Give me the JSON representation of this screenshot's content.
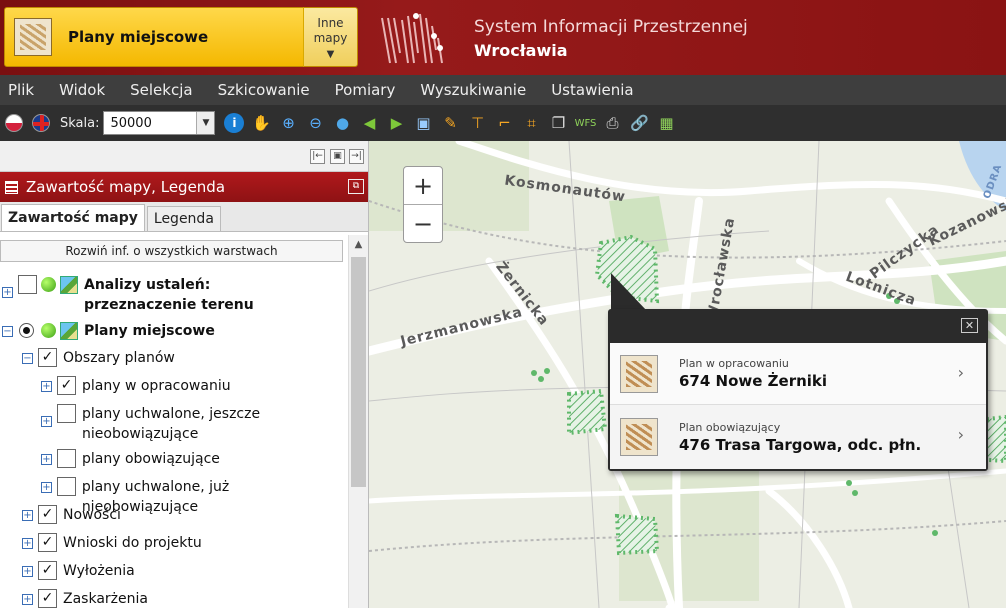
{
  "header": {
    "plan_title": "Plany miejscowe",
    "other_maps_line1": "Inne",
    "other_maps_line2": "mapy",
    "system_line1": "System Informacji Przestrzennej",
    "system_line2": "Wrocławia"
  },
  "menu": [
    "Plik",
    "Widok",
    "Selekcja",
    "Szkicowanie",
    "Pomiary",
    "Wyszukiwanie",
    "Ustawienia"
  ],
  "toolbar": {
    "scale_label": "Skala:",
    "scale_value": "50000",
    "tools": [
      "pan-hand",
      "zoom-in",
      "zoom-out",
      "globe",
      "back-arrow",
      "forward-arrow",
      "select",
      "pencil",
      "measure-distance",
      "measure-angle",
      "crop",
      "layers",
      "wfs",
      "print",
      "link",
      "export"
    ]
  },
  "left_panel": {
    "title": "Zawartość mapy, Legenda",
    "tabs": [
      "Zawartość mapy",
      "Legenda"
    ],
    "expand_all": "Rozwiń inf. o wszystkich warstwach",
    "tree": [
      {
        "label": "Analizy ustaleń: przeznaczenie terenu",
        "bold": true,
        "checked": false
      },
      {
        "label": "Plany miejscowe",
        "bold": true,
        "checked": true
      },
      {
        "label": "Obszary planów",
        "checked": true
      },
      {
        "label": "plany w opracowaniu",
        "checked": true
      },
      {
        "label": "plany uchwalone, jeszcze nieobowiązujące",
        "checked": false
      },
      {
        "label": "plany obowiązujące",
        "checked": false
      },
      {
        "label": "plany uchwalone, już nieobowiązujące",
        "checked": false
      },
      {
        "label": "Nowości",
        "checked": true
      },
      {
        "label": "Wnioski do projektu",
        "checked": true
      },
      {
        "label": "Wyłożenia",
        "checked": true
      },
      {
        "label": "Zaskarżenia",
        "checked": true
      }
    ]
  },
  "map": {
    "zoom_in": "+",
    "zoom_out": "−",
    "labels": [
      "Kosmonautów",
      "Żernicka",
      "Jerzmanowska",
      "Pilczycka",
      "Kozanowska",
      "Lotnicza",
      "ODRA",
      "Wrocławska"
    ],
    "popup": [
      {
        "category": "Plan w opracowaniu",
        "name": "674 Nowe Żerniki"
      },
      {
        "category": "Plan obowiązujący",
        "name": "476 Trasa Targowa, odc. płn."
      }
    ]
  }
}
